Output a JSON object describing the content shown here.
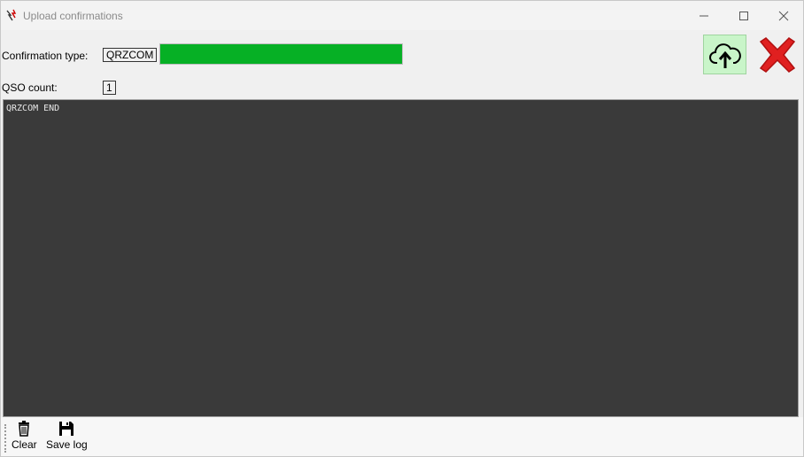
{
  "window": {
    "title": "Upload confirmations"
  },
  "form": {
    "confirmation_type_label": "Confirmation type:",
    "confirmation_type_value": "QRZCOM",
    "progress_percent": 100,
    "qso_count_label": "QSO count:",
    "qso_count_value": "1"
  },
  "log": {
    "text": "QRZCOM END"
  },
  "toolbar": {
    "clear_label": "Clear",
    "save_log_label": "Save log"
  },
  "colors": {
    "progress": "#06b025",
    "log_bg": "#3a3a3a",
    "upload_bg": "#c9f5c9",
    "cancel": "#e02020"
  },
  "icons": {
    "app": "app-icon",
    "minimize": "minimize-icon",
    "maximize": "maximize-icon",
    "close": "close-icon",
    "upload": "cloud-upload-icon",
    "cancel": "red-x-icon",
    "clear": "trash-icon",
    "save": "floppy-disk-icon"
  }
}
